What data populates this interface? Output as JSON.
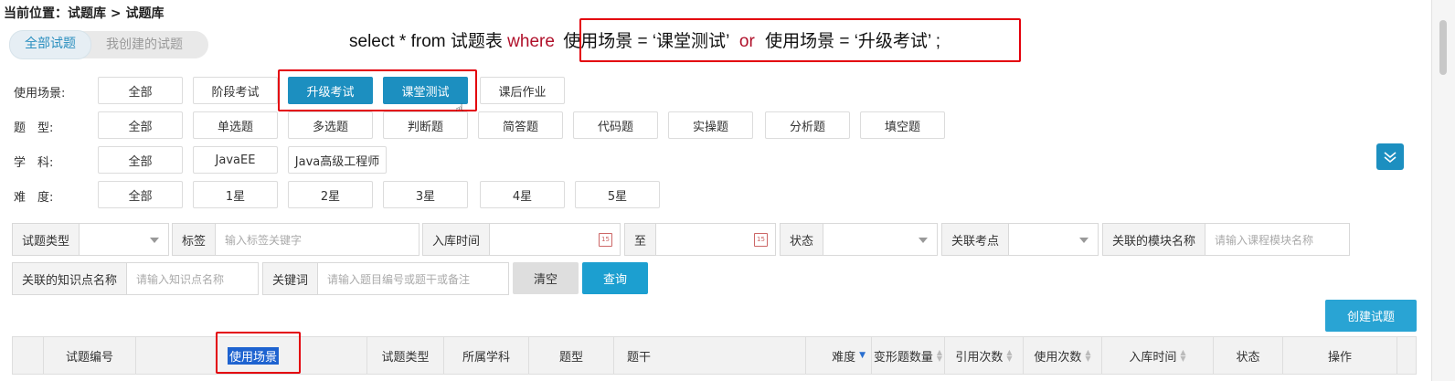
{
  "breadcrumb": "当前位置：试题库 > 试题库",
  "tabs": {
    "all": "全部试题",
    "mine": "我创建的试题"
  },
  "sql": {
    "prefix": "select * from 试题表 ",
    "where": "where",
    "cond1": "使用场景 =   ‘课堂测试’",
    "or": "or",
    "cond2": "使用场景 =   ‘升级考试’",
    "suffix": " ;"
  },
  "filters": {
    "scene": {
      "label": "使用场景:",
      "options": [
        "全部",
        "阶段考试",
        "升级考试",
        "课堂测试",
        "课后作业"
      ]
    },
    "qtype": {
      "label": "题　型:",
      "options": [
        "全部",
        "单选题",
        "多选题",
        "判断题",
        "简答题",
        "代码题",
        "实操题",
        "分析题",
        "填空题"
      ]
    },
    "subject": {
      "label": "学　科:",
      "options": [
        "全部",
        "JavaEE",
        "Java高级工程师"
      ]
    },
    "difficulty": {
      "label": "难　度:",
      "options": [
        "全部",
        "1星",
        "2星",
        "3星",
        "4星",
        "5星"
      ]
    }
  },
  "search": {
    "qtype": {
      "label": "试题类型",
      "value": ""
    },
    "tag": {
      "label": "标签",
      "placeholder": "输入标签关键字"
    },
    "date_from": {
      "label": "入库时间",
      "value": ""
    },
    "date_to": {
      "label": "至",
      "value": ""
    },
    "status": {
      "label": "状态",
      "value": ""
    },
    "point": {
      "label": "关联考点",
      "value": ""
    },
    "module": {
      "label": "关联的模块名称",
      "placeholder": "请输入课程模块名称"
    },
    "knowledge": {
      "label": "关联的知识点名称",
      "placeholder": "请输入知识点名称"
    },
    "keyword": {
      "label": "关键词",
      "placeholder": "请输入题目编号或题干或备注"
    },
    "clear": "清空",
    "query": "查询"
  },
  "create_button": "创建试题",
  "table": {
    "columns": [
      "试题编号",
      "使用场景",
      "试题类型",
      "所属学科",
      "题型",
      "题干",
      "难度",
      "变形题数量",
      "引用次数",
      "使用次数",
      "入库时间",
      "状态",
      "操作"
    ]
  },
  "cal_icon_text": "15"
}
